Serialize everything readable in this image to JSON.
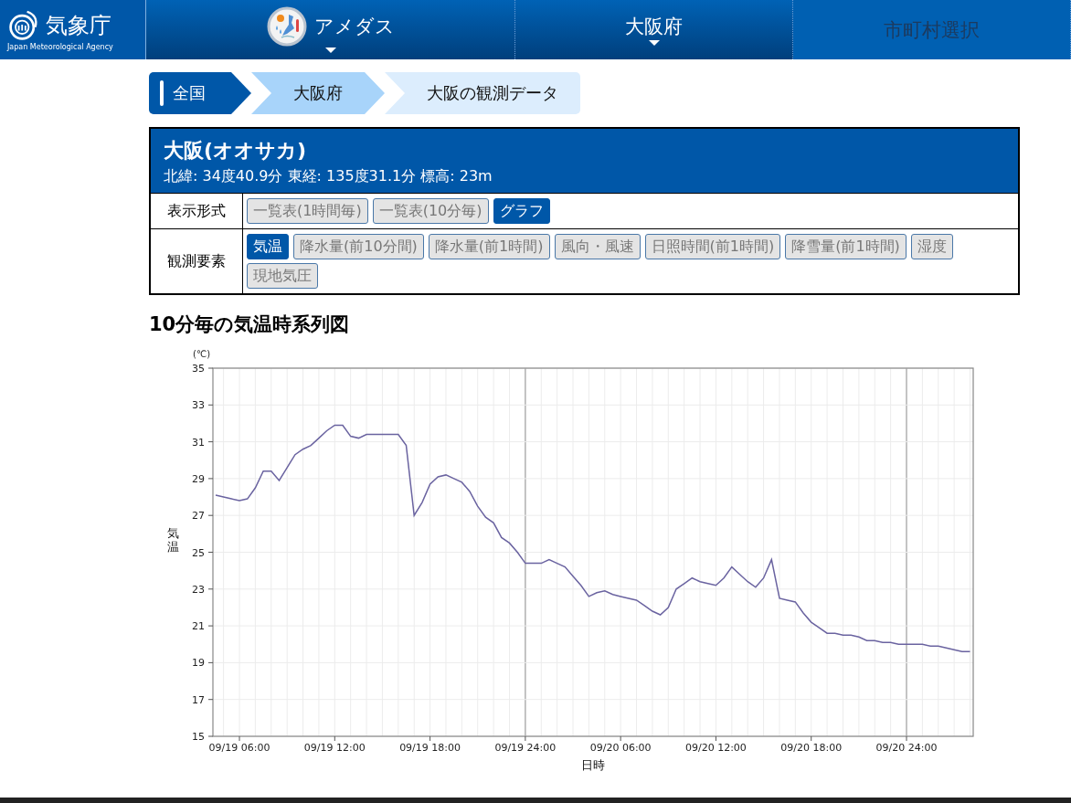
{
  "header": {
    "logo_text": "気象庁",
    "logo_subtitle": "Japan Meteorological Agency",
    "nav": [
      {
        "label": "アメダス",
        "dropdown": true,
        "disabled": false
      },
      {
        "label": "大阪府",
        "dropdown": true,
        "disabled": false
      },
      {
        "label": "市町村選択",
        "dropdown": false,
        "disabled": true
      }
    ]
  },
  "breadcrumb": [
    {
      "label": "全国",
      "color": "#0057a8"
    },
    {
      "label": "大阪府",
      "color": "#a8d4fa"
    },
    {
      "label": "大阪の観測データ",
      "color": "#dcedfd"
    }
  ],
  "station": {
    "name": "大阪(オオサカ)",
    "location": "北緯: 34度40.9分 東経: 135度31.1分 標高: 23m",
    "rows": [
      {
        "label": "表示形式",
        "options": [
          {
            "label": "一覧表(1時間毎)",
            "selected": false
          },
          {
            "label": "一覧表(10分毎)",
            "selected": false
          },
          {
            "label": "グラフ",
            "selected": true
          }
        ]
      },
      {
        "label": "観測要素",
        "options": [
          {
            "label": "気温",
            "selected": true
          },
          {
            "label": "降水量(前10分間)",
            "selected": false
          },
          {
            "label": "降水量(前1時間)",
            "selected": false
          },
          {
            "label": "風向・風速",
            "selected": false
          },
          {
            "label": "日照時間(前1時間)",
            "selected": false
          },
          {
            "label": "降雪量(前1時間)",
            "selected": false
          },
          {
            "label": "湿度",
            "selected": false
          },
          {
            "label": "現地気圧",
            "selected": false
          }
        ]
      }
    ]
  },
  "chart": {
    "unit": "(℃)",
    "chart_data": {
      "type": "line",
      "title": "10分毎の気温時系列図",
      "xlabel": "日時",
      "ylabel": "気温",
      "categories": [
        null,
        null,
        null,
        "09/19 06:00",
        null,
        null,
        null,
        null,
        null,
        null,
        null,
        null,
        null,
        null,
        null,
        "09/19 12:00",
        null,
        null,
        null,
        null,
        null,
        null,
        null,
        null,
        null,
        null,
        null,
        "09/19 18:00",
        null,
        null,
        null,
        null,
        null,
        null,
        null,
        null,
        null,
        null,
        null,
        "09/19 24:00",
        null,
        null,
        null,
        null,
        null,
        null,
        null,
        null,
        null,
        null,
        null,
        "09/20 06:00",
        null,
        null,
        null,
        null,
        null,
        null,
        null,
        null,
        null,
        null,
        null,
        "09/20 12:00",
        null,
        null,
        null,
        null,
        null,
        null,
        null,
        null,
        null,
        null,
        null,
        "09/20 18:00",
        null,
        null,
        null,
        null,
        null,
        null,
        null,
        null,
        null,
        null,
        null,
        "09/20 24:00",
        null,
        null,
        null,
        null,
        null,
        null,
        null,
        null
      ],
      "series": [
        {
          "color": "#6a63a0",
          "values": [
            28.1,
            28.0,
            27.9,
            27.8,
            27.9,
            28.5,
            29.4,
            29.4,
            28.9,
            29.6,
            30.3,
            30.6,
            30.8,
            31.2,
            31.6,
            31.9,
            31.9,
            31.3,
            31.2,
            31.4,
            31.4,
            31.4,
            31.4,
            31.4,
            30.8,
            27.0,
            27.7,
            28.7,
            29.1,
            29.2,
            29.0,
            28.8,
            28.3,
            27.5,
            26.9,
            26.6,
            25.8,
            25.5,
            25.0,
            24.4,
            24.4,
            24.4,
            24.6,
            24.4,
            24.2,
            23.7,
            23.2,
            22.6,
            22.8,
            22.9,
            22.7,
            22.6,
            22.5,
            22.4,
            22.1,
            21.8,
            21.6,
            22.0,
            23.0,
            23.3,
            23.6,
            23.4,
            23.3,
            23.2,
            23.6,
            24.2,
            23.8,
            23.4,
            23.1,
            23.6,
            24.6,
            22.5,
            22.4,
            22.3,
            21.7,
            21.2,
            20.9,
            20.6,
            20.6,
            20.5,
            20.5,
            20.4,
            20.2,
            20.2,
            20.1,
            20.1,
            20.0,
            20.0,
            20.0,
            20.0,
            19.9,
            19.9,
            19.8,
            19.7,
            19.6,
            19.6
          ]
        }
      ],
      "grid": true,
      "ylim": [
        15,
        35
      ],
      "yticks": [
        15,
        17,
        19,
        21,
        23,
        25,
        27,
        29,
        31,
        33,
        35
      ]
    }
  }
}
